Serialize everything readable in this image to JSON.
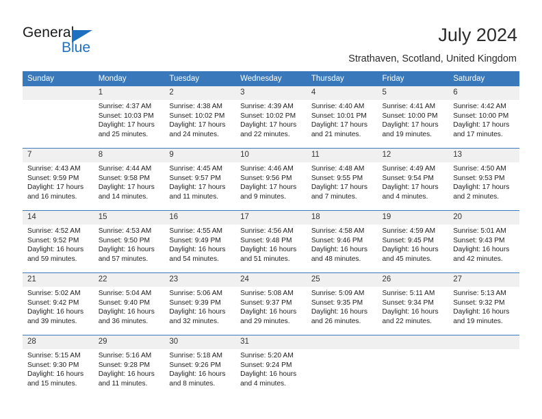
{
  "brand": {
    "name_part1": "General",
    "name_part2": "Blue",
    "triangle_color": "#1f70c1",
    "accent_color": "#3878bb"
  },
  "header": {
    "title": "July 2024",
    "subtitle": "Strathaven, Scotland, United Kingdom"
  },
  "calendar": {
    "weekday_headers": [
      "Sunday",
      "Monday",
      "Tuesday",
      "Wednesday",
      "Thursday",
      "Friday",
      "Saturday"
    ],
    "weeks": [
      [
        {
          "day": "",
          "sunrise": "",
          "sunset": "",
          "daylight_line1": "",
          "daylight_line2": ""
        },
        {
          "day": "1",
          "sunrise": "Sunrise: 4:37 AM",
          "sunset": "Sunset: 10:03 PM",
          "daylight_line1": "Daylight: 17 hours",
          "daylight_line2": "and 25 minutes."
        },
        {
          "day": "2",
          "sunrise": "Sunrise: 4:38 AM",
          "sunset": "Sunset: 10:02 PM",
          "daylight_line1": "Daylight: 17 hours",
          "daylight_line2": "and 24 minutes."
        },
        {
          "day": "3",
          "sunrise": "Sunrise: 4:39 AM",
          "sunset": "Sunset: 10:02 PM",
          "daylight_line1": "Daylight: 17 hours",
          "daylight_line2": "and 22 minutes."
        },
        {
          "day": "4",
          "sunrise": "Sunrise: 4:40 AM",
          "sunset": "Sunset: 10:01 PM",
          "daylight_line1": "Daylight: 17 hours",
          "daylight_line2": "and 21 minutes."
        },
        {
          "day": "5",
          "sunrise": "Sunrise: 4:41 AM",
          "sunset": "Sunset: 10:00 PM",
          "daylight_line1": "Daylight: 17 hours",
          "daylight_line2": "and 19 minutes."
        },
        {
          "day": "6",
          "sunrise": "Sunrise: 4:42 AM",
          "sunset": "Sunset: 10:00 PM",
          "daylight_line1": "Daylight: 17 hours",
          "daylight_line2": "and 17 minutes."
        }
      ],
      [
        {
          "day": "7",
          "sunrise": "Sunrise: 4:43 AM",
          "sunset": "Sunset: 9:59 PM",
          "daylight_line1": "Daylight: 17 hours",
          "daylight_line2": "and 16 minutes."
        },
        {
          "day": "8",
          "sunrise": "Sunrise: 4:44 AM",
          "sunset": "Sunset: 9:58 PM",
          "daylight_line1": "Daylight: 17 hours",
          "daylight_line2": "and 14 minutes."
        },
        {
          "day": "9",
          "sunrise": "Sunrise: 4:45 AM",
          "sunset": "Sunset: 9:57 PM",
          "daylight_line1": "Daylight: 17 hours",
          "daylight_line2": "and 11 minutes."
        },
        {
          "day": "10",
          "sunrise": "Sunrise: 4:46 AM",
          "sunset": "Sunset: 9:56 PM",
          "daylight_line1": "Daylight: 17 hours",
          "daylight_line2": "and 9 minutes."
        },
        {
          "day": "11",
          "sunrise": "Sunrise: 4:48 AM",
          "sunset": "Sunset: 9:55 PM",
          "daylight_line1": "Daylight: 17 hours",
          "daylight_line2": "and 7 minutes."
        },
        {
          "day": "12",
          "sunrise": "Sunrise: 4:49 AM",
          "sunset": "Sunset: 9:54 PM",
          "daylight_line1": "Daylight: 17 hours",
          "daylight_line2": "and 4 minutes."
        },
        {
          "day": "13",
          "sunrise": "Sunrise: 4:50 AM",
          "sunset": "Sunset: 9:53 PM",
          "daylight_line1": "Daylight: 17 hours",
          "daylight_line2": "and 2 minutes."
        }
      ],
      [
        {
          "day": "14",
          "sunrise": "Sunrise: 4:52 AM",
          "sunset": "Sunset: 9:52 PM",
          "daylight_line1": "Daylight: 16 hours",
          "daylight_line2": "and 59 minutes."
        },
        {
          "day": "15",
          "sunrise": "Sunrise: 4:53 AM",
          "sunset": "Sunset: 9:50 PM",
          "daylight_line1": "Daylight: 16 hours",
          "daylight_line2": "and 57 minutes."
        },
        {
          "day": "16",
          "sunrise": "Sunrise: 4:55 AM",
          "sunset": "Sunset: 9:49 PM",
          "daylight_line1": "Daylight: 16 hours",
          "daylight_line2": "and 54 minutes."
        },
        {
          "day": "17",
          "sunrise": "Sunrise: 4:56 AM",
          "sunset": "Sunset: 9:48 PM",
          "daylight_line1": "Daylight: 16 hours",
          "daylight_line2": "and 51 minutes."
        },
        {
          "day": "18",
          "sunrise": "Sunrise: 4:58 AM",
          "sunset": "Sunset: 9:46 PM",
          "daylight_line1": "Daylight: 16 hours",
          "daylight_line2": "and 48 minutes."
        },
        {
          "day": "19",
          "sunrise": "Sunrise: 4:59 AM",
          "sunset": "Sunset: 9:45 PM",
          "daylight_line1": "Daylight: 16 hours",
          "daylight_line2": "and 45 minutes."
        },
        {
          "day": "20",
          "sunrise": "Sunrise: 5:01 AM",
          "sunset": "Sunset: 9:43 PM",
          "daylight_line1": "Daylight: 16 hours",
          "daylight_line2": "and 42 minutes."
        }
      ],
      [
        {
          "day": "21",
          "sunrise": "Sunrise: 5:02 AM",
          "sunset": "Sunset: 9:42 PM",
          "daylight_line1": "Daylight: 16 hours",
          "daylight_line2": "and 39 minutes."
        },
        {
          "day": "22",
          "sunrise": "Sunrise: 5:04 AM",
          "sunset": "Sunset: 9:40 PM",
          "daylight_line1": "Daylight: 16 hours",
          "daylight_line2": "and 36 minutes."
        },
        {
          "day": "23",
          "sunrise": "Sunrise: 5:06 AM",
          "sunset": "Sunset: 9:39 PM",
          "daylight_line1": "Daylight: 16 hours",
          "daylight_line2": "and 32 minutes."
        },
        {
          "day": "24",
          "sunrise": "Sunrise: 5:08 AM",
          "sunset": "Sunset: 9:37 PM",
          "daylight_line1": "Daylight: 16 hours",
          "daylight_line2": "and 29 minutes."
        },
        {
          "day": "25",
          "sunrise": "Sunrise: 5:09 AM",
          "sunset": "Sunset: 9:35 PM",
          "daylight_line1": "Daylight: 16 hours",
          "daylight_line2": "and 26 minutes."
        },
        {
          "day": "26",
          "sunrise": "Sunrise: 5:11 AM",
          "sunset": "Sunset: 9:34 PM",
          "daylight_line1": "Daylight: 16 hours",
          "daylight_line2": "and 22 minutes."
        },
        {
          "day": "27",
          "sunrise": "Sunrise: 5:13 AM",
          "sunset": "Sunset: 9:32 PM",
          "daylight_line1": "Daylight: 16 hours",
          "daylight_line2": "and 19 minutes."
        }
      ],
      [
        {
          "day": "28",
          "sunrise": "Sunrise: 5:15 AM",
          "sunset": "Sunset: 9:30 PM",
          "daylight_line1": "Daylight: 16 hours",
          "daylight_line2": "and 15 minutes."
        },
        {
          "day": "29",
          "sunrise": "Sunrise: 5:16 AM",
          "sunset": "Sunset: 9:28 PM",
          "daylight_line1": "Daylight: 16 hours",
          "daylight_line2": "and 11 minutes."
        },
        {
          "day": "30",
          "sunrise": "Sunrise: 5:18 AM",
          "sunset": "Sunset: 9:26 PM",
          "daylight_line1": "Daylight: 16 hours",
          "daylight_line2": "and 8 minutes."
        },
        {
          "day": "31",
          "sunrise": "Sunrise: 5:20 AM",
          "sunset": "Sunset: 9:24 PM",
          "daylight_line1": "Daylight: 16 hours",
          "daylight_line2": "and 4 minutes."
        },
        {
          "day": "",
          "sunrise": "",
          "sunset": "",
          "daylight_line1": "",
          "daylight_line2": ""
        },
        {
          "day": "",
          "sunrise": "",
          "sunset": "",
          "daylight_line1": "",
          "daylight_line2": ""
        },
        {
          "day": "",
          "sunrise": "",
          "sunset": "",
          "daylight_line1": "",
          "daylight_line2": ""
        }
      ]
    ]
  }
}
